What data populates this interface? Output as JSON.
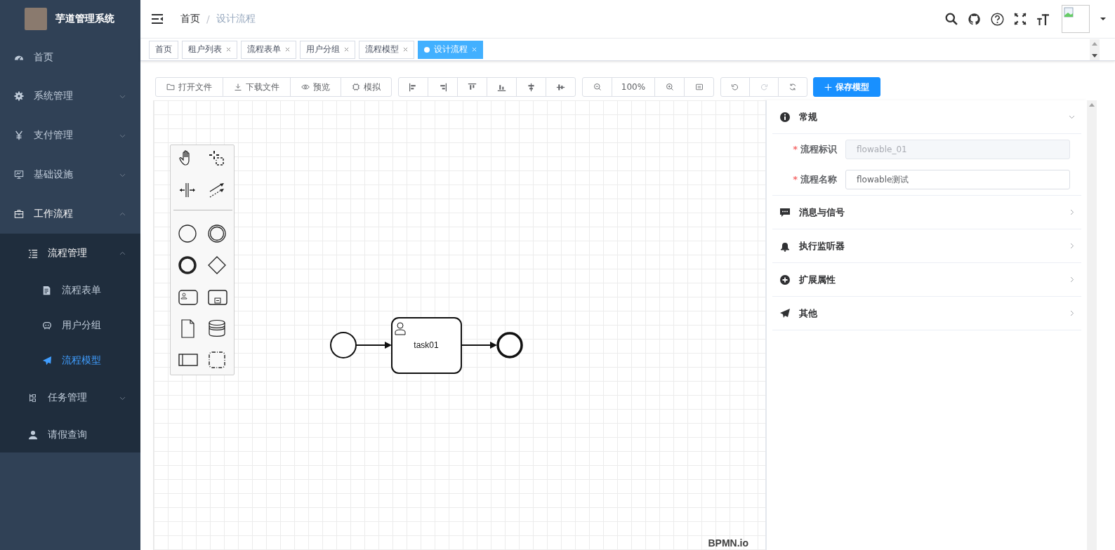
{
  "sidebar": {
    "title": "芋道管理系统",
    "items": [
      {
        "label": "首页",
        "selected": false
      },
      {
        "label": "系统管理",
        "expanded": false,
        "selected": false
      },
      {
        "label": "支付管理",
        "expanded": false,
        "selected": false
      },
      {
        "label": "基础设施",
        "expanded": false,
        "selected": false
      },
      {
        "label": "工作流程",
        "expanded": true,
        "selected": false,
        "children": [
          {
            "label": "流程管理",
            "expanded": true,
            "selected": false,
            "children": [
              {
                "label": "流程表单",
                "selected": false
              },
              {
                "label": "用户分组",
                "selected": false
              },
              {
                "label": "流程模型",
                "selected": true
              }
            ]
          },
          {
            "label": "任务管理",
            "expanded": false,
            "selected": false
          },
          {
            "label": "请假查询",
            "selected": false
          }
        ]
      }
    ]
  },
  "breadcrumb": {
    "items": [
      "首页",
      "设计流程"
    ],
    "separator": "/"
  },
  "tabs": [
    {
      "label": "首页",
      "closable": false,
      "selected": false
    },
    {
      "label": "租户列表",
      "closable": true,
      "selected": false
    },
    {
      "label": "流程表单",
      "closable": true,
      "selected": false
    },
    {
      "label": "用户分组",
      "closable": true,
      "selected": false
    },
    {
      "label": "流程模型",
      "closable": true,
      "selected": false
    },
    {
      "label": "设计流程",
      "closable": true,
      "selected": true
    }
  ],
  "toolbar": {
    "file_buttons": [
      "打开文件",
      "下载文件",
      "预览",
      "模拟"
    ],
    "zoom": "100%",
    "history_buttons": [
      {
        "disabled": false
      },
      {
        "disabled": true
      },
      {
        "disabled": false
      }
    ],
    "save_button": "保存模型"
  },
  "diagram": {
    "task_label": "task01",
    "logo": "BPMN.io"
  },
  "properties": {
    "required_mark": "*",
    "sections": [
      {
        "title": "常规",
        "expanded": true,
        "fields": [
          {
            "label": "流程标识",
            "required": true,
            "value": "flowable_01",
            "disabled": true
          },
          {
            "label": "流程名称",
            "required": true,
            "value": "flowable测试",
            "disabled": false
          }
        ]
      },
      {
        "title": "消息与信号",
        "expanded": false
      },
      {
        "title": "执行监听器",
        "expanded": false
      },
      {
        "title": "扩展属性",
        "expanded": false
      },
      {
        "title": "其他",
        "expanded": false
      }
    ]
  }
}
